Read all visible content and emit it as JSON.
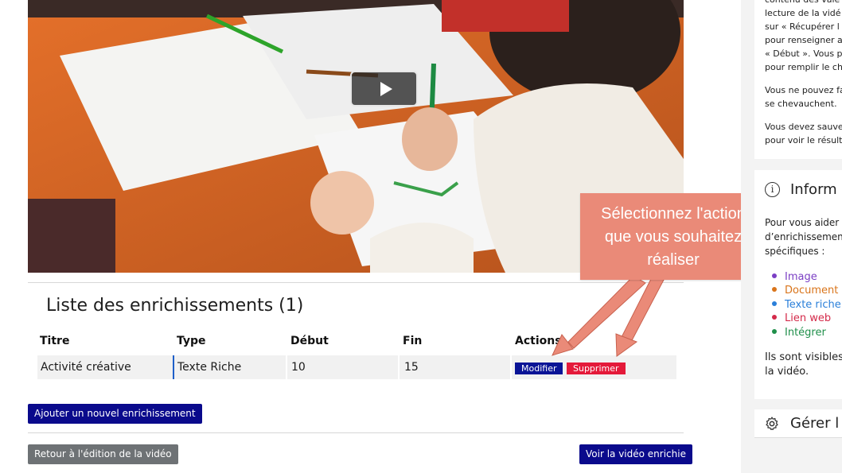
{
  "video": {
    "play_label": "Lire la vidéo"
  },
  "enrichments": {
    "title": "Liste des enrichissements (1)",
    "columns": [
      "Titre",
      "Type",
      "Début",
      "Fin",
      "Actions"
    ],
    "rows": [
      {
        "titre": "Activité créative",
        "type": "Texte Riche",
        "debut": "10",
        "fin": "15"
      }
    ],
    "modify_label": "Modifier",
    "delete_label": "Supprimer"
  },
  "buttons": {
    "add": "Ajouter un nouvel enrichissement",
    "back": "Retour à l'édition de la vidéo",
    "view": "Voir la vidéo enrichie"
  },
  "callout": {
    "lines": [
      "Sélectionnez l'action",
      "que vous souhaitez",
      "réaliser"
    ],
    "color": "#ea8a78"
  },
  "sidebar": {
    "help_lines": [
      "contenu des vale",
      "lecture de la vidé",
      "sur « Récupérer l",
      "pour renseigner a",
      "« Début ». Vous p",
      "pour remplir le ch"
    ],
    "overlap_lines": [
      "Vous ne pouvez fa",
      "se chevauchent."
    ],
    "save_lines": [
      "Vous devez sauve",
      "pour voir le résult"
    ],
    "info_heading": "Inform",
    "info_lines": [
      "Pour vous aider",
      "d’enrichissemen",
      "spécifiques :"
    ],
    "legend": [
      {
        "label": "Image",
        "color": "#7b3fc4"
      },
      {
        "label": "Document",
        "color": "#d9741a"
      },
      {
        "label": "Texte riche",
        "color": "#2a7fd9"
      },
      {
        "label": "Lien web",
        "color": "#d42a4a"
      },
      {
        "label": "Intégrer",
        "color": "#1f8f4a"
      }
    ],
    "visible_lines": [
      "Ils sont visibles",
      "la vidéo."
    ],
    "manage_heading": "Gérer l",
    "info_icon": "info-icon",
    "manage_icon": "gear-icon"
  }
}
